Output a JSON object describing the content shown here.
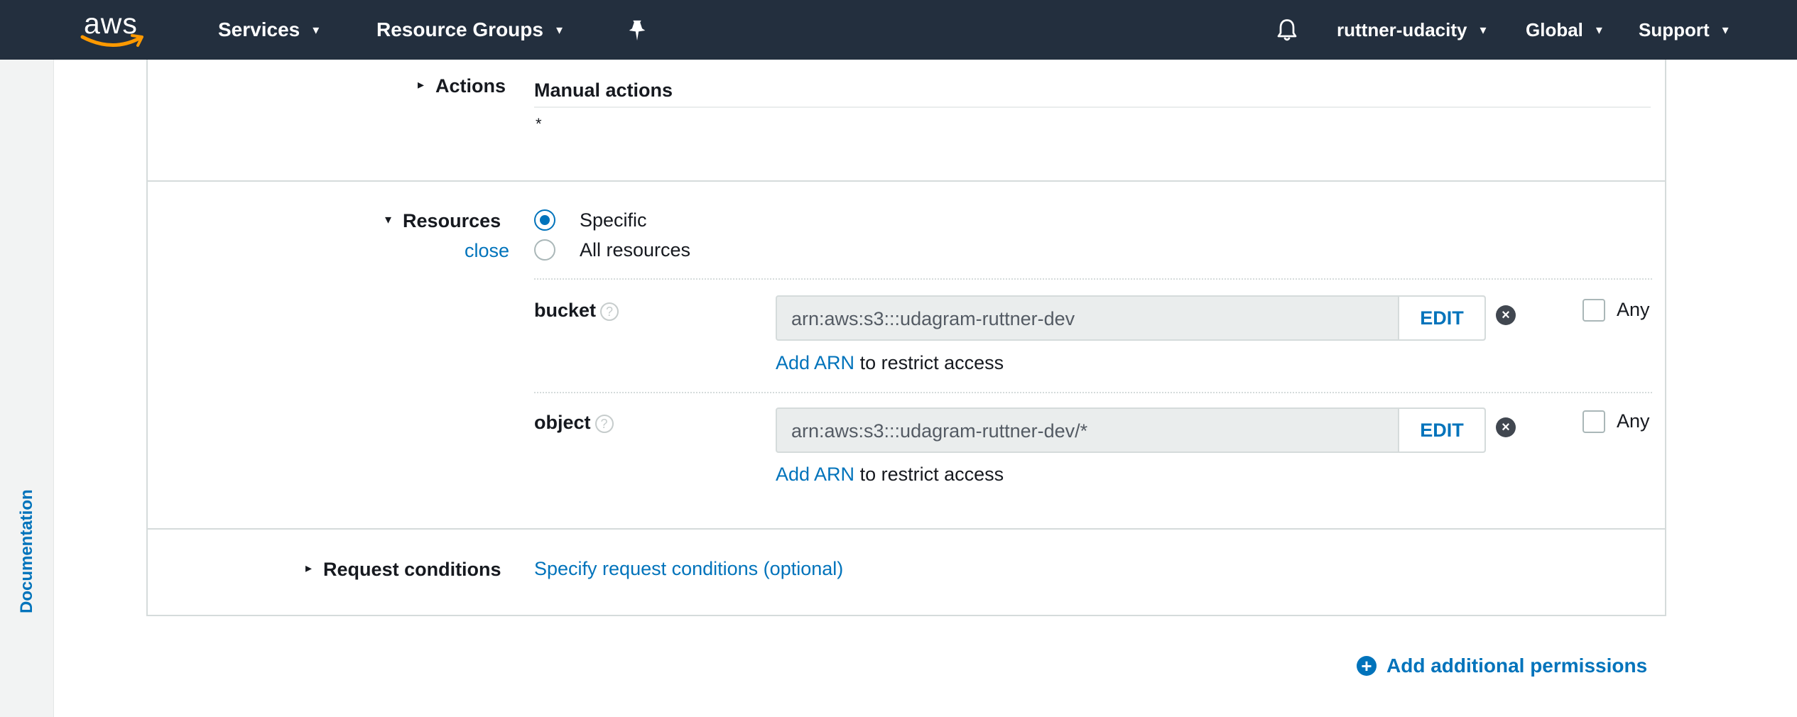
{
  "nav": {
    "logo": "aws",
    "services": "Services",
    "resource_groups": "Resource Groups",
    "account": "ruttner-udacity",
    "region": "Global",
    "support": "Support"
  },
  "sidebar": {
    "documentation": "Documentation"
  },
  "actions": {
    "label": "Actions",
    "heading": "Manual actions",
    "value": "*"
  },
  "resources": {
    "label": "Resources",
    "close_link": "close",
    "options": [
      {
        "label": "Specific",
        "selected": true
      },
      {
        "label": "All resources",
        "selected": false
      }
    ],
    "entries": [
      {
        "type": "bucket",
        "arn": "arn:aws:s3:::udagram-ruttner-dev",
        "edit": "EDIT",
        "add_arn": "Add ARN",
        "add_arn_suffix": "to restrict access",
        "any": "Any"
      },
      {
        "type": "object",
        "arn": "arn:aws:s3:::udagram-ruttner-dev/*",
        "edit": "EDIT",
        "add_arn": "Add ARN",
        "add_arn_suffix": "to restrict access",
        "any": "Any"
      }
    ]
  },
  "conditions": {
    "label": "Request conditions",
    "link": "Specify request conditions (optional)"
  },
  "footer": {
    "add_permissions": "Add additional permissions"
  },
  "colors": {
    "nav_bg": "#232f3e",
    "link": "#0073bb",
    "logo_smile": "#ff9900"
  }
}
